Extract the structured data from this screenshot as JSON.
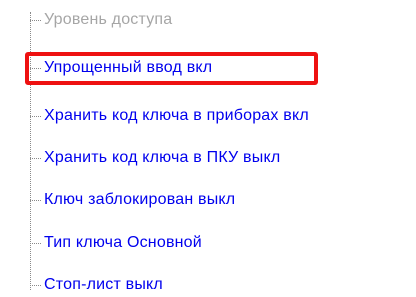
{
  "tree": {
    "items": [
      {
        "label": "Уровень доступа",
        "state": "disabled"
      },
      {
        "label": "Упрощенный ввод  вкл",
        "state": "highlighted"
      },
      {
        "label": "Хранить код ключа в приборах  вкл",
        "state": "normal"
      },
      {
        "label": "Хранить код ключа в ПКУ  выкл",
        "state": "normal"
      },
      {
        "label": "Ключ заблокирован  выкл",
        "state": "normal"
      },
      {
        "label": "Тип ключа  Основной",
        "state": "normal"
      },
      {
        "label": "Стоп-лист  выкл",
        "state": "normal"
      }
    ]
  },
  "colors": {
    "link": "#0000ee",
    "disabled": "#a6a6a6",
    "highlight_border": "#ee1111",
    "tree_lines": "#8a8a8a"
  }
}
